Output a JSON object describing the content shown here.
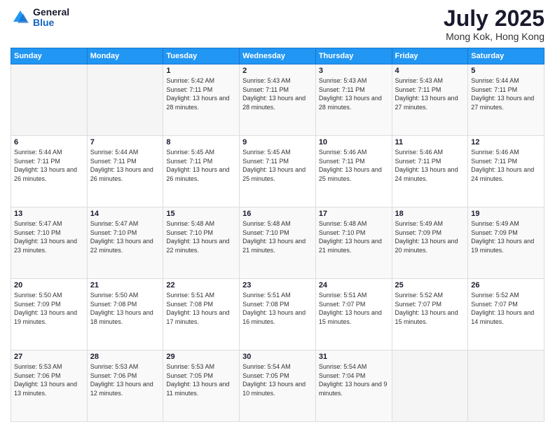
{
  "logo": {
    "general": "General",
    "blue": "Blue"
  },
  "title": {
    "month_year": "July 2025",
    "location": "Mong Kok, Hong Kong"
  },
  "headers": [
    "Sunday",
    "Monday",
    "Tuesday",
    "Wednesday",
    "Thursday",
    "Friday",
    "Saturday"
  ],
  "weeks": [
    [
      {
        "day": "",
        "sunrise": "",
        "sunset": "",
        "daylight": ""
      },
      {
        "day": "",
        "sunrise": "",
        "sunset": "",
        "daylight": ""
      },
      {
        "day": "1",
        "sunrise": "Sunrise: 5:42 AM",
        "sunset": "Sunset: 7:11 PM",
        "daylight": "Daylight: 13 hours and 28 minutes."
      },
      {
        "day": "2",
        "sunrise": "Sunrise: 5:43 AM",
        "sunset": "Sunset: 7:11 PM",
        "daylight": "Daylight: 13 hours and 28 minutes."
      },
      {
        "day": "3",
        "sunrise": "Sunrise: 5:43 AM",
        "sunset": "Sunset: 7:11 PM",
        "daylight": "Daylight: 13 hours and 28 minutes."
      },
      {
        "day": "4",
        "sunrise": "Sunrise: 5:43 AM",
        "sunset": "Sunset: 7:11 PM",
        "daylight": "Daylight: 13 hours and 27 minutes."
      },
      {
        "day": "5",
        "sunrise": "Sunrise: 5:44 AM",
        "sunset": "Sunset: 7:11 PM",
        "daylight": "Daylight: 13 hours and 27 minutes."
      }
    ],
    [
      {
        "day": "6",
        "sunrise": "Sunrise: 5:44 AM",
        "sunset": "Sunset: 7:11 PM",
        "daylight": "Daylight: 13 hours and 26 minutes."
      },
      {
        "day": "7",
        "sunrise": "Sunrise: 5:44 AM",
        "sunset": "Sunset: 7:11 PM",
        "daylight": "Daylight: 13 hours and 26 minutes."
      },
      {
        "day": "8",
        "sunrise": "Sunrise: 5:45 AM",
        "sunset": "Sunset: 7:11 PM",
        "daylight": "Daylight: 13 hours and 26 minutes."
      },
      {
        "day": "9",
        "sunrise": "Sunrise: 5:45 AM",
        "sunset": "Sunset: 7:11 PM",
        "daylight": "Daylight: 13 hours and 25 minutes."
      },
      {
        "day": "10",
        "sunrise": "Sunrise: 5:46 AM",
        "sunset": "Sunset: 7:11 PM",
        "daylight": "Daylight: 13 hours and 25 minutes."
      },
      {
        "day": "11",
        "sunrise": "Sunrise: 5:46 AM",
        "sunset": "Sunset: 7:11 PM",
        "daylight": "Daylight: 13 hours and 24 minutes."
      },
      {
        "day": "12",
        "sunrise": "Sunrise: 5:46 AM",
        "sunset": "Sunset: 7:11 PM",
        "daylight": "Daylight: 13 hours and 24 minutes."
      }
    ],
    [
      {
        "day": "13",
        "sunrise": "Sunrise: 5:47 AM",
        "sunset": "Sunset: 7:10 PM",
        "daylight": "Daylight: 13 hours and 23 minutes."
      },
      {
        "day": "14",
        "sunrise": "Sunrise: 5:47 AM",
        "sunset": "Sunset: 7:10 PM",
        "daylight": "Daylight: 13 hours and 22 minutes."
      },
      {
        "day": "15",
        "sunrise": "Sunrise: 5:48 AM",
        "sunset": "Sunset: 7:10 PM",
        "daylight": "Daylight: 13 hours and 22 minutes."
      },
      {
        "day": "16",
        "sunrise": "Sunrise: 5:48 AM",
        "sunset": "Sunset: 7:10 PM",
        "daylight": "Daylight: 13 hours and 21 minutes."
      },
      {
        "day": "17",
        "sunrise": "Sunrise: 5:48 AM",
        "sunset": "Sunset: 7:10 PM",
        "daylight": "Daylight: 13 hours and 21 minutes."
      },
      {
        "day": "18",
        "sunrise": "Sunrise: 5:49 AM",
        "sunset": "Sunset: 7:09 PM",
        "daylight": "Daylight: 13 hours and 20 minutes."
      },
      {
        "day": "19",
        "sunrise": "Sunrise: 5:49 AM",
        "sunset": "Sunset: 7:09 PM",
        "daylight": "Daylight: 13 hours and 19 minutes."
      }
    ],
    [
      {
        "day": "20",
        "sunrise": "Sunrise: 5:50 AM",
        "sunset": "Sunset: 7:09 PM",
        "daylight": "Daylight: 13 hours and 19 minutes."
      },
      {
        "day": "21",
        "sunrise": "Sunrise: 5:50 AM",
        "sunset": "Sunset: 7:08 PM",
        "daylight": "Daylight: 13 hours and 18 minutes."
      },
      {
        "day": "22",
        "sunrise": "Sunrise: 5:51 AM",
        "sunset": "Sunset: 7:08 PM",
        "daylight": "Daylight: 13 hours and 17 minutes."
      },
      {
        "day": "23",
        "sunrise": "Sunrise: 5:51 AM",
        "sunset": "Sunset: 7:08 PM",
        "daylight": "Daylight: 13 hours and 16 minutes."
      },
      {
        "day": "24",
        "sunrise": "Sunrise: 5:51 AM",
        "sunset": "Sunset: 7:07 PM",
        "daylight": "Daylight: 13 hours and 15 minutes."
      },
      {
        "day": "25",
        "sunrise": "Sunrise: 5:52 AM",
        "sunset": "Sunset: 7:07 PM",
        "daylight": "Daylight: 13 hours and 15 minutes."
      },
      {
        "day": "26",
        "sunrise": "Sunrise: 5:52 AM",
        "sunset": "Sunset: 7:07 PM",
        "daylight": "Daylight: 13 hours and 14 minutes."
      }
    ],
    [
      {
        "day": "27",
        "sunrise": "Sunrise: 5:53 AM",
        "sunset": "Sunset: 7:06 PM",
        "daylight": "Daylight: 13 hours and 13 minutes."
      },
      {
        "day": "28",
        "sunrise": "Sunrise: 5:53 AM",
        "sunset": "Sunset: 7:06 PM",
        "daylight": "Daylight: 13 hours and 12 minutes."
      },
      {
        "day": "29",
        "sunrise": "Sunrise: 5:53 AM",
        "sunset": "Sunset: 7:05 PM",
        "daylight": "Daylight: 13 hours and 11 minutes."
      },
      {
        "day": "30",
        "sunrise": "Sunrise: 5:54 AM",
        "sunset": "Sunset: 7:05 PM",
        "daylight": "Daylight: 13 hours and 10 minutes."
      },
      {
        "day": "31",
        "sunrise": "Sunrise: 5:54 AM",
        "sunset": "Sunset: 7:04 PM",
        "daylight": "Daylight: 13 hours and 9 minutes."
      },
      {
        "day": "",
        "sunrise": "",
        "sunset": "",
        "daylight": ""
      },
      {
        "day": "",
        "sunrise": "",
        "sunset": "",
        "daylight": ""
      }
    ]
  ]
}
